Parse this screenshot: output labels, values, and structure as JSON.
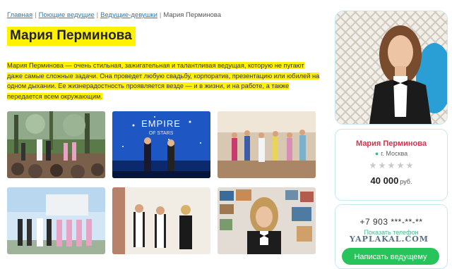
{
  "breadcrumb": {
    "home": "Главная",
    "singers": "Поющие ведущие",
    "hosts": "Ведущие-девушки",
    "current": "Мария Перминова",
    "separator": "|"
  },
  "profile": {
    "title": "Мария Перминова",
    "description": "Мария Перминова — очень стильная, зажигательная и талантливая ведущая, которую не пугают даже самые сложные задачи. Она проведет любую свадьбу, корпоратив, презентацию или юбилей на одном дыхании. Ее жизнерадостность проявляется везде — и в жизни, и на работе, а также передается всем окружающим."
  },
  "gallery": {
    "empire_text_1": "EMPIRE",
    "empire_text_2": "OF STARS"
  },
  "card": {
    "name": "Мария Перминова",
    "city": "г. Москва",
    "rating": 0,
    "rating_max": 5,
    "price": "40 000",
    "price_unit": "руб."
  },
  "contact": {
    "phone": "+7 903 ***-**-**",
    "show_phone": "Показать телефон",
    "write_button": "Написать ведущему"
  },
  "watermark": "YAPLAKAL.COM",
  "colors": {
    "highlight": "#fff200",
    "link": "#2a7ab8",
    "name": "#d3344c",
    "accent_green": "#27c35b"
  }
}
